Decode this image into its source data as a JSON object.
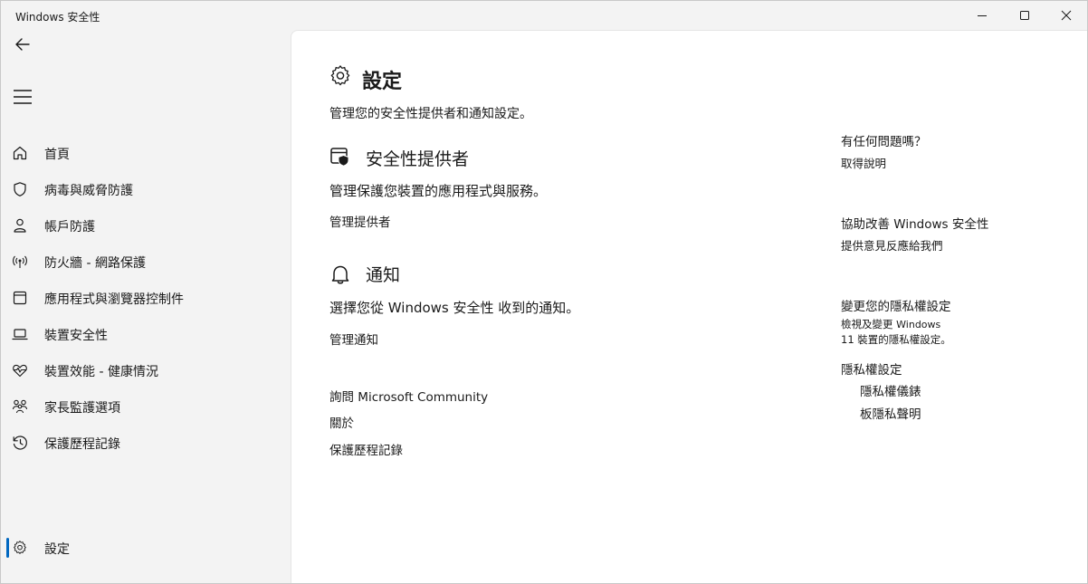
{
  "window": {
    "title": "Windows 安全性",
    "controls": {
      "minimize": "minimize-icon",
      "maximize": "maximize-icon",
      "close": "close-icon"
    }
  },
  "nav": {
    "back_icon": "back-arrow-icon",
    "menu_icon": "hamburger-icon",
    "items": [
      {
        "label": "首頁",
        "icon": "home-icon"
      },
      {
        "label": "病毒與威脅防護",
        "icon": "shield-icon"
      },
      {
        "label": "帳戶防護",
        "icon": "person-icon"
      },
      {
        "label": "防火牆 - 網路保護",
        "icon": "antenna-icon"
      },
      {
        "label": "應用程式與瀏覽器控制件",
        "icon": "app-window-icon"
      },
      {
        "label": "裝置安全性",
        "icon": "laptop-icon"
      },
      {
        "label": "裝置效能 - 健康情況",
        "icon": "heart-pulse-icon"
      },
      {
        "label": "家長監護選項",
        "icon": "family-icon"
      },
      {
        "label": "保護歷程記錄",
        "icon": "history-icon"
      }
    ],
    "settings": {
      "label": "設定",
      "icon": "gear-icon",
      "selected": true
    },
    "accent_color": "#0067c0"
  },
  "main": {
    "title": "設定",
    "subtitle": "管理您的安全性提供者和通知設定。",
    "providers": {
      "title": "安全性提供者",
      "desc": "管理保護您裝置的應用程式與服務。",
      "link": "管理提供者"
    },
    "notifications": {
      "title": "通知",
      "desc": "選擇您從 Windows 安全性 收到的通知。",
      "link": "管理通知"
    },
    "links": {
      "community": "詢問 Microsoft Community",
      "about": "關於",
      "history": "保護歷程記錄"
    }
  },
  "sidebar": {
    "help_heading": "有任何問題嗎？",
    "help_link": "取得說明",
    "improve_heading": "協助改善 Windows 安全性",
    "improve_link": "提供意見反應給我們",
    "privacy_heading": "變更您的隱私權設定",
    "privacy_text_1": "檢視及變更",
    "privacy_text_2": "Windows",
    "privacy_text_3": "11 裝置的隱私權設定。",
    "privacy_settings_link": "隱私權設定",
    "privacy_dashboard_link": "隱私權儀錶",
    "privacy_statement_link": "板隱私聲明"
  }
}
